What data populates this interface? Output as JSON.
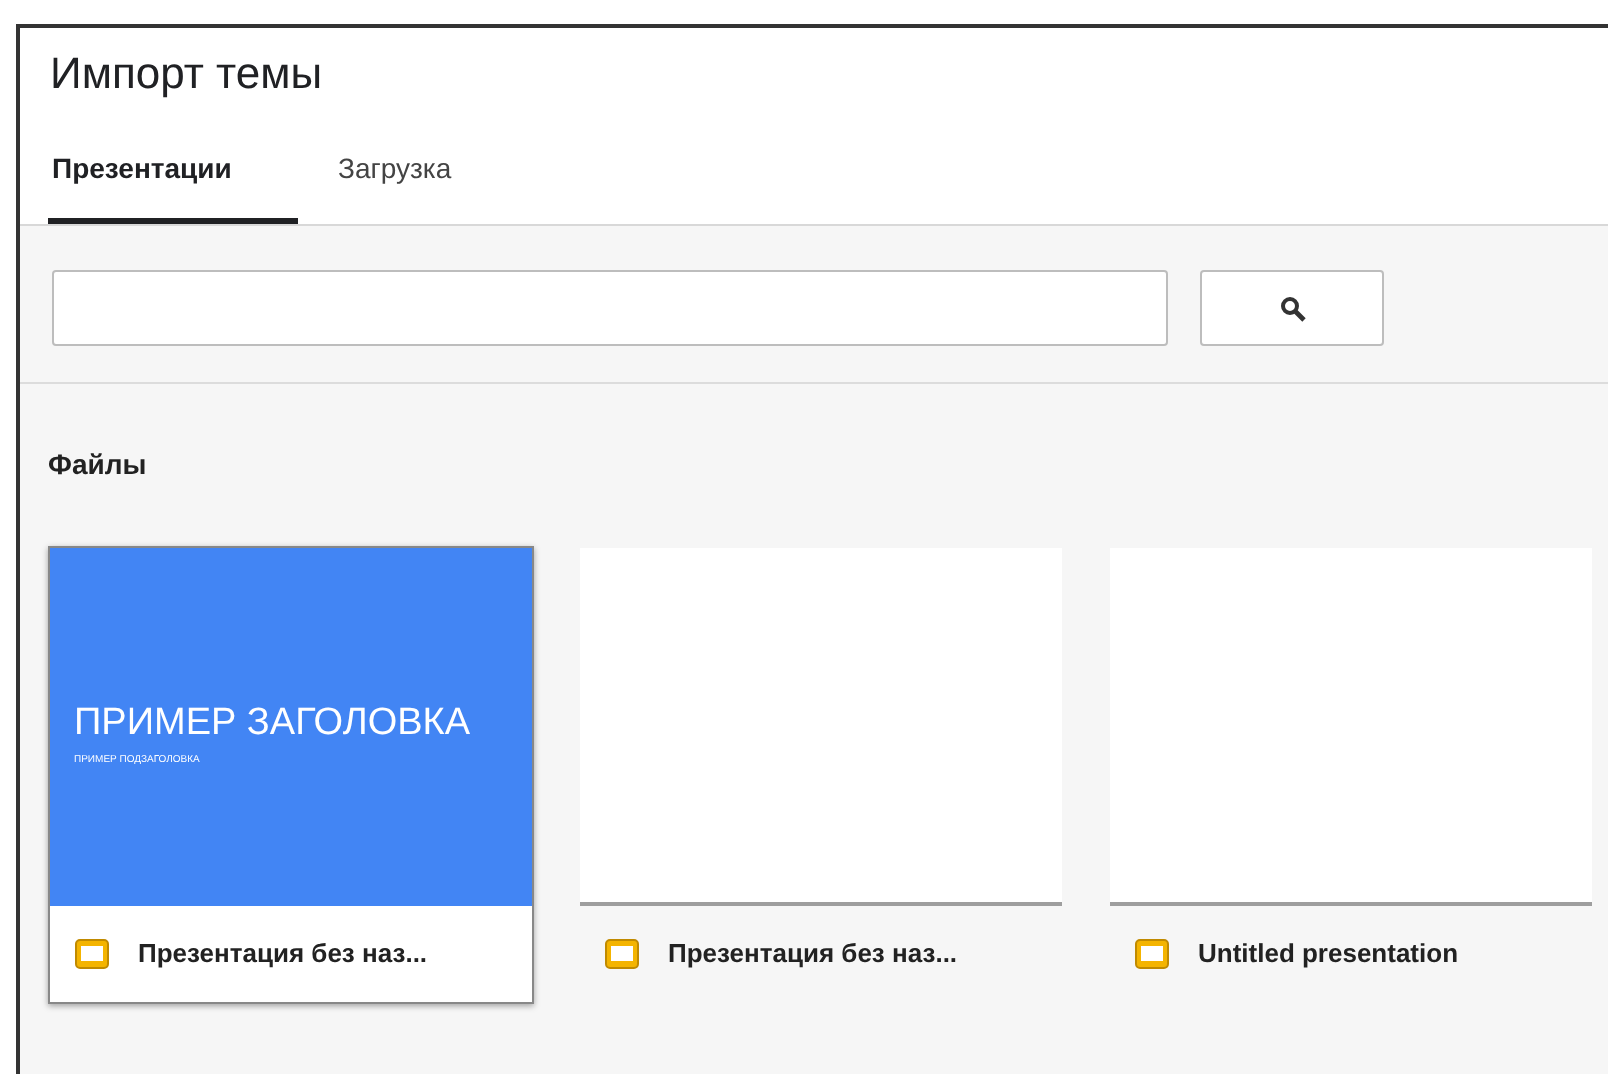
{
  "dialog": {
    "title": "Импорт темы"
  },
  "tabs": [
    {
      "label": "Презентации",
      "selected": true
    },
    {
      "label": "Загрузка",
      "selected": false
    }
  ],
  "section_label": "Файлы",
  "files": [
    {
      "name": "Презентация без наз...",
      "selected": true,
      "thumbnail": {
        "kind": "title-slide",
        "title": "ПРИМЕР ЗАГОЛОВКА",
        "subtitle": "ПРИМЕР ПОДЗАГОЛОВКА"
      }
    },
    {
      "name": "Презентация без наз...",
      "selected": false,
      "thumbnail": {
        "kind": "blank"
      }
    },
    {
      "name": "Untitled presentation",
      "selected": false,
      "thumbnail": {
        "kind": "blank"
      }
    }
  ]
}
